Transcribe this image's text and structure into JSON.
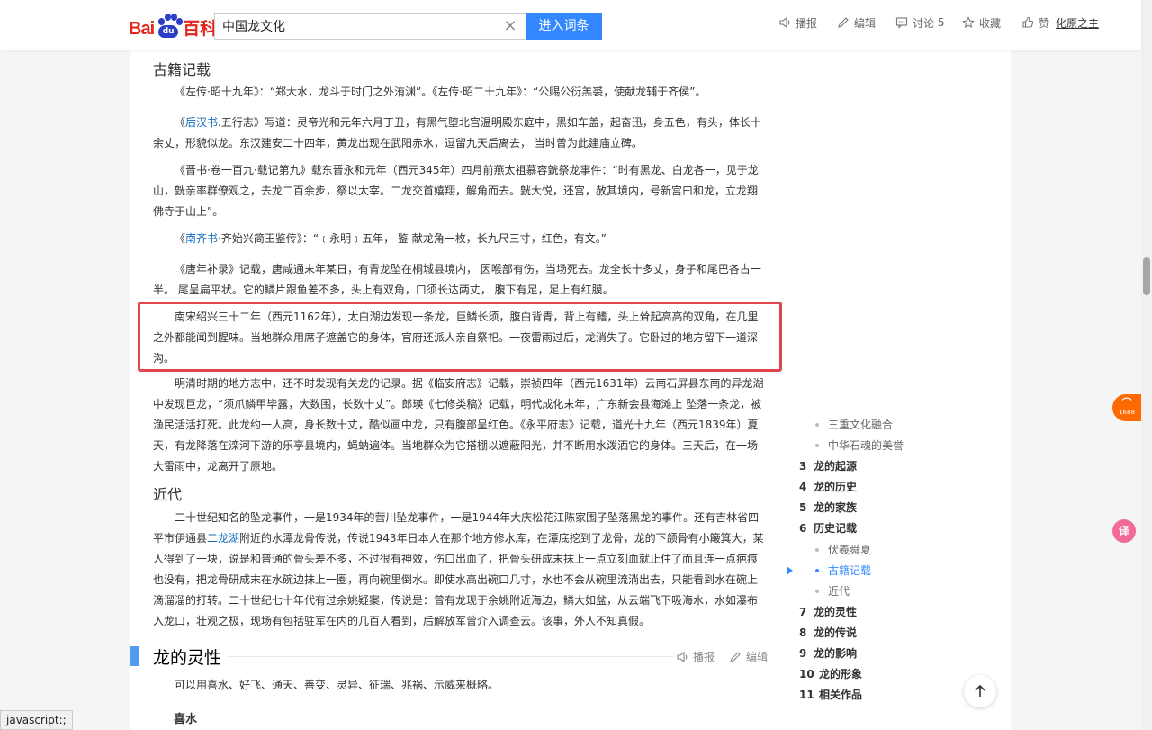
{
  "header": {
    "logo_bai": "Bai",
    "logo_du": "du",
    "logo_baike": "百科",
    "search_value": "中国龙文化",
    "search_button": "进入词条",
    "tools": {
      "broadcast": "播报",
      "edit": "编辑",
      "discuss": "讨论",
      "discuss_count": "5",
      "favorite": "收藏",
      "like": "赞",
      "user": "化原之主"
    }
  },
  "article": {
    "h_ancient": "古籍记载",
    "p1": "《左传·昭十九年》：“郑大水，龙斗于时门之外洧渊”。《左传·昭二十九年》：“公赐公衍羔裘，使献龙辅于齐侯”。",
    "p2_link": "后汉书",
    "p2_pre": "《",
    "p2_rest": ".五行志》写道：灵帝光和元年六月丁丑，有黑气堕北宫温明殿东庭中，黑如车盖，起奋迅，身五色，有头，体长十余丈，形貌似龙。东汉建安二十四年，黄龙出现在武阳赤水，逗留九天后离去，  当时曾为此建庙立碑。",
    "p3": "《晋书·卷一百九·载记第九》载东晋永和元年（西元345年）四月前燕太祖慕容皝祭龙事件：“时有黑龙、白龙各一，见于龙山，皝亲率群僚观之，去龙二百余步，祭以太宰。二龙交首嬉翔，解角而去。皝大悦，还宫，赦其境内，号新宫曰和龙，立龙翔佛寺于山上”。",
    "p4_pre": "《",
    "p4_link": "南齐书",
    "p4_rest": "·齐始兴简王鉴传》：“﹝永明﹞五年，  鉴 献龙角一枚，长九尺三寸，红色，有文。”",
    "p5": "《唐年补录》记载，唐咸通末年某日，有青龙坠在桐城县境内，  因喉部有伤，当场死去。龙全长十多丈，身子和尾巴各占一半。 尾呈扁平状。它的鳞片跟鱼差不多，头上有双角，口须长达两丈，  腹下有足，足上有红膜。",
    "p6": "南宋绍兴三十二年（西元1162年），太白湖边发现一条龙，巨鳞长须，腹白背青，背上有鳍，头上耸起高高的双角，在几里之外都能闻到腥味。当地群众用席子遮盖它的身体，官府还派人亲自祭祀。一夜雷雨过后，龙消失了。它卧过的地方留下一道深沟。",
    "p7": "明清时期的地方志中，还不时发现有关龙的记录。据《临安府志》记载，崇祯四年（西元1631年）云南石屏县东南的异龙湖中发现巨龙，“须爪鳞甲毕露，大数围，长数十丈”。郎瑛《七修类稿》记载，明代成化末年，广东新会县海滩上 坠落一条龙，被渔民活活打死。此龙约一人高，身长数十丈，酷似画中龙，只有腹部呈红色。《永平府志》记载，道光十九年（西元1839年）夏天，有龙降落在滦河下游的乐亭县境内，蝇蚋遍体。当地群众为它搭棚以遮蔽阳光，并不断用水泼洒它的身体。三天后，在一场大雷雨中，龙离开了原地。",
    "h_modern": "近代",
    "p8_pre": "二十世纪知名的坠龙事件，一是1934年的营川坠龙事件，一是1944年大庆松花江陈家围子坠落黑龙的事件。还有吉林省四平市伊通县",
    "p8_link": "二龙湖",
    "p8_rest": "附近的水潭龙骨传说，传说1943年日本人在那个地方修水库，在潭底挖到了龙骨，龙的下颌骨有小簸箕大，某人得到了一块，说是和普通的骨头差不多，不过很有神效，伤口出血了，把骨头研成末抹上一点立刻血就止住了而且连一点疤痕也没有，把龙骨研成末在水碗边抹上一圈，再向碗里倒水。即使水高出碗口几寸，水也不会从碗里流淌出去，只能看到水在碗上滴溜溜的打转。二十世纪七十年代有过余姚疑案，传说是：曾有龙现于余姚附近海边，鳞大如盆，从云端飞下吸海水，水如瀑布入龙口，壮观之极，现场有包括驻军在内的几百人看到，后解放军曾介入调查云。该事，外人不知真假。",
    "section_title": "龙的灵性",
    "section_broadcast": "播报",
    "section_edit": "编辑",
    "p9": "可以用喜水、好飞、通天、善变、灵异、征瑞、兆祸、示威来概略。",
    "sub_h": "喜水"
  },
  "toc": {
    "items": [
      {
        "num": "",
        "label": "三重文化融合"
      },
      {
        "num": "",
        "label": "中华石魂的美誉"
      },
      {
        "num": "3",
        "label": "龙的起源"
      },
      {
        "num": "4",
        "label": "龙的历史"
      },
      {
        "num": "5",
        "label": "龙的家族"
      },
      {
        "num": "6",
        "label": "历史记载"
      },
      {
        "num": "",
        "label": "伏羲舜夏"
      },
      {
        "num": "",
        "label": "古籍记载"
      },
      {
        "num": "",
        "label": "近代"
      },
      {
        "num": "7",
        "label": "龙的灵性"
      },
      {
        "num": "8",
        "label": "龙的传说"
      },
      {
        "num": "9",
        "label": "龙的影响"
      },
      {
        "num": "10",
        "label": "龙的形象"
      },
      {
        "num": "11",
        "label": "相关作品"
      }
    ]
  },
  "side": {
    "badge": "1688",
    "translate": "译"
  },
  "statusbar": "javascript:;",
  "colors": {
    "accent": "#3388ff",
    "link": "#136ec2",
    "highlight": "#e0464b",
    "logo_red": "#e1261c",
    "logo_blue": "#2c3dc8"
  }
}
